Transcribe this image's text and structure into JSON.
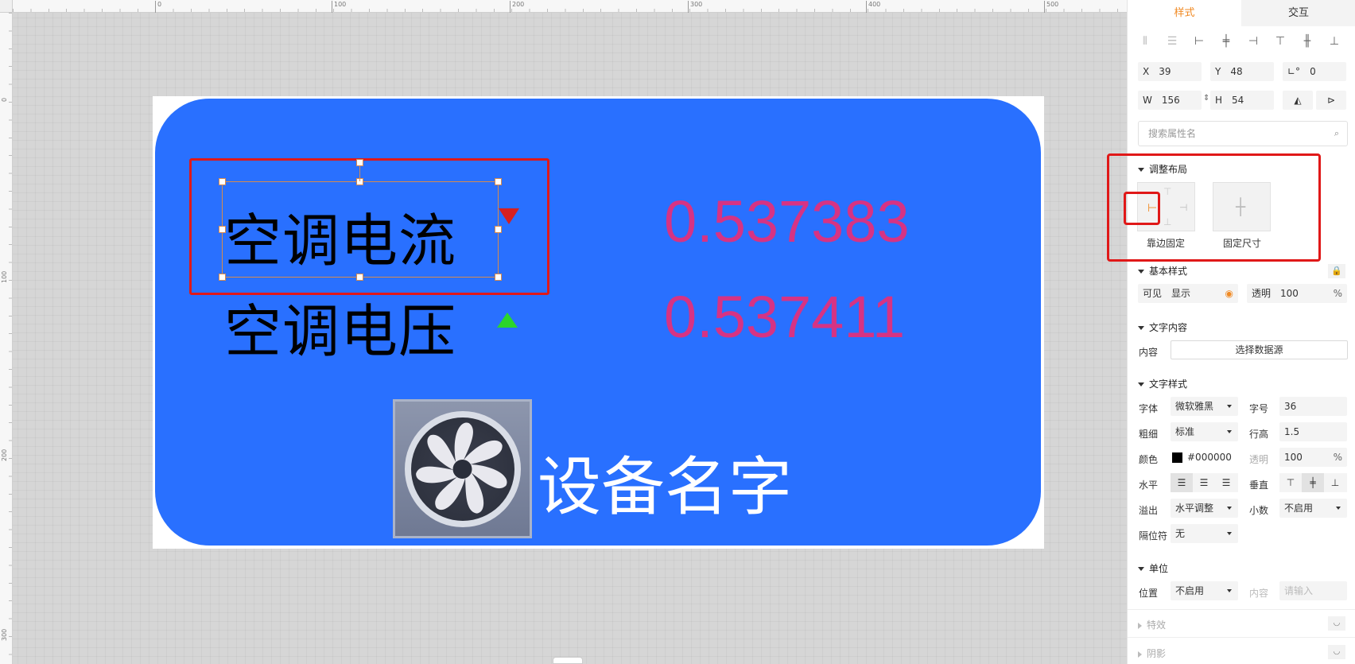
{
  "ruler": {
    "top_ticks": [
      "0",
      "100",
      "200",
      "300",
      "400",
      "500"
    ],
    "left_ticks": [
      "0",
      "100",
      "200",
      "300"
    ]
  },
  "artboard": {
    "label_current": "空调电流",
    "label_voltage": "空调电压",
    "value_current": "0.537383",
    "value_voltage": "0.537411",
    "device_name": "设备名字",
    "panel_color": "#2970ff",
    "value_color": "#d63384"
  },
  "sidebar": {
    "tabs": [
      "样式",
      "交互"
    ],
    "geometry": {
      "x_label": "X",
      "x_value": "39",
      "y_label": "Y",
      "y_value": "48",
      "rot_label": "∟°",
      "rot_value": "0",
      "w_label": "W",
      "w_value": "156",
      "h_label": "H",
      "h_value": "54"
    },
    "search_placeholder": "搜索属性名",
    "layout": {
      "title": "调整布局",
      "option1": "靠边固定",
      "option2": "固定尺寸"
    },
    "basic": {
      "title": "基本样式",
      "visible_label": "可见",
      "visible_value": "显示",
      "opacity_label": "透明",
      "opacity_value": "100",
      "percent": "%"
    },
    "text_content": {
      "title": "文字内容",
      "content_label": "内容",
      "datasource_button": "选择数据源"
    },
    "text_style": {
      "title": "文字样式",
      "font_label": "字体",
      "font_value": "微软雅黑",
      "size_label": "字号",
      "size_value": "36",
      "weight_label": "粗细",
      "weight_value": "标准",
      "lineheight_label": "行高",
      "lineheight_value": "1.5",
      "color_label": "颜色",
      "color_value": "#000000",
      "opacity_label": "透明",
      "opacity_value": "100",
      "percent": "%",
      "halign_label": "水平",
      "valign_label": "垂直",
      "overflow_label": "溢出",
      "overflow_value": "水平调整",
      "decimal_label": "小数",
      "decimal_value": "不启用",
      "separator_label": "隔位符",
      "separator_value": "无"
    },
    "unit": {
      "title": "单位",
      "position_label": "位置",
      "position_value": "不启用",
      "content_label": "内容",
      "content_placeholder": "请输入"
    },
    "effects_title": "特效",
    "shadow_title": "阴影",
    "accent_color": "#f08a24"
  }
}
